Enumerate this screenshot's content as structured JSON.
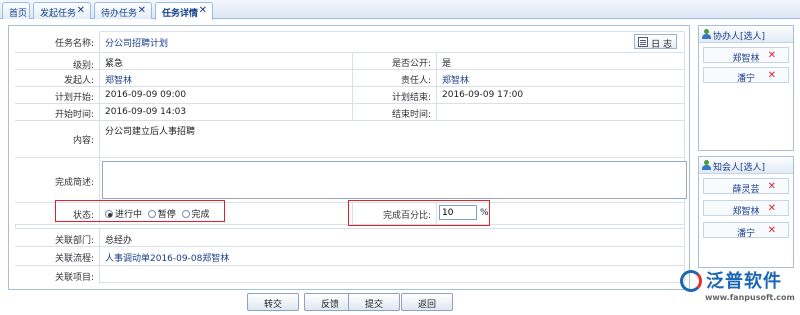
{
  "tabs": [
    {
      "label": "首页",
      "closable": false
    },
    {
      "label": "发起任务",
      "closable": true
    },
    {
      "label": "待办任务",
      "closable": true
    },
    {
      "label": "任务详情",
      "closable": true,
      "active": true
    }
  ],
  "form": {
    "task_name_label": "任务名称:",
    "task_name": "分公司招聘计划",
    "log_button": "日 志",
    "level_label": "级别:",
    "level": "紧急",
    "public_label": "是否公开:",
    "public": "是",
    "initiator_label": "发起人:",
    "initiator": "郑智林",
    "owner_label": "责任人:",
    "owner": "郑智林",
    "plan_start_label": "计划开始:",
    "plan_start": "2016-09-09 09:00",
    "plan_end_label": "计划结束:",
    "plan_end": "2016-09-09 17:00",
    "start_time_label": "开始时间:",
    "start_time": "2016-09-09 14:03",
    "end_time_label": "结束时间:",
    "end_time": "",
    "content_label": "内容:",
    "content": "分公司建立后人事招聘",
    "done_label": "完成简述:",
    "done": "",
    "status_label": "状态:",
    "status_options": [
      "进行中",
      "暂停",
      "完成"
    ],
    "status_selected": "进行中",
    "percent_label": "完成百分比:",
    "percent_value": "10",
    "percent_unit": "%",
    "dept_label": "关联部门:",
    "dept": "总经办",
    "flow_label": "关联流程:",
    "flow": "人事调动单2016-09-08郑智林",
    "project_label": "关联项目:",
    "project": ""
  },
  "assistants": {
    "title": "协办人[选人]",
    "items": [
      "郑智林",
      "潘宁"
    ]
  },
  "notified": {
    "title": "知会人[选人]",
    "items": [
      "薛灵芸",
      "郑智林",
      "潘宁"
    ]
  },
  "buttons": {
    "transfer": "转交",
    "feedback": "反馈",
    "submit": "提交",
    "back": "返回"
  },
  "logo": {
    "name": "泛普软件",
    "url": "www.fanpusoft.com"
  },
  "colors": {
    "accent": "#1b67b6",
    "highlight_box": "#d9252a",
    "delete": "#dd2233"
  }
}
